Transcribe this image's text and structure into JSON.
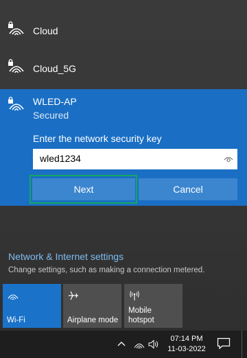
{
  "networks": [
    {
      "name": "Cloud"
    },
    {
      "name": "Cloud_5G"
    }
  ],
  "selected_network": {
    "name": "WLED-AP",
    "status": "Secured",
    "key_label": "Enter the network security key",
    "key_value": "wled1234",
    "next_label": "Next",
    "cancel_label": "Cancel"
  },
  "settings": {
    "link": "Network & Internet settings",
    "description": "Change settings, such as making a connection metered."
  },
  "quick_actions": [
    {
      "label": "Wi-Fi",
      "icon": "wifi-icon",
      "active": true
    },
    {
      "label": "Airplane mode",
      "icon": "airplane-icon",
      "active": false
    },
    {
      "label": "Mobile hotspot",
      "icon": "hotspot-icon",
      "active": false
    }
  ],
  "taskbar": {
    "time": "07:14 PM",
    "date": "11-03-2022"
  },
  "colors": {
    "accent": "#1a6fc4",
    "button": "#3c86cf",
    "focus": "#15a760",
    "link": "#7fbcf0"
  }
}
